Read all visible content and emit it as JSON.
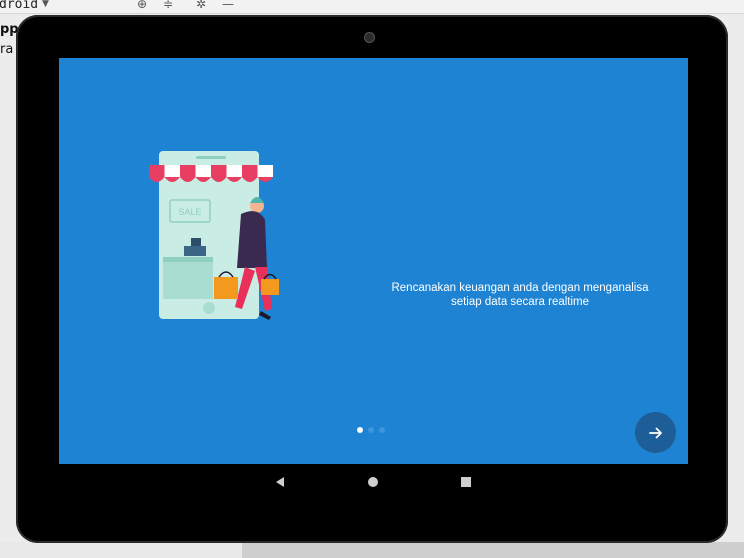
{
  "ide": {
    "title": "droid",
    "left_line1": "pp",
    "left_line2": "ra"
  },
  "screen": {
    "background_color": "#1e83d2",
    "message": "Rencanakan keuangan anda dengan menganalisa setiap data secara realtime",
    "illustration": {
      "sign_text": "SALE",
      "icon": "shop-illustration"
    },
    "pager": {
      "count": 3,
      "active_index": 0
    },
    "next_button": {
      "icon": "arrow-right-icon",
      "color": "#1d5e99"
    }
  },
  "navigation_bar": {
    "buttons": [
      "back-icon",
      "home-icon",
      "recents-icon"
    ]
  }
}
